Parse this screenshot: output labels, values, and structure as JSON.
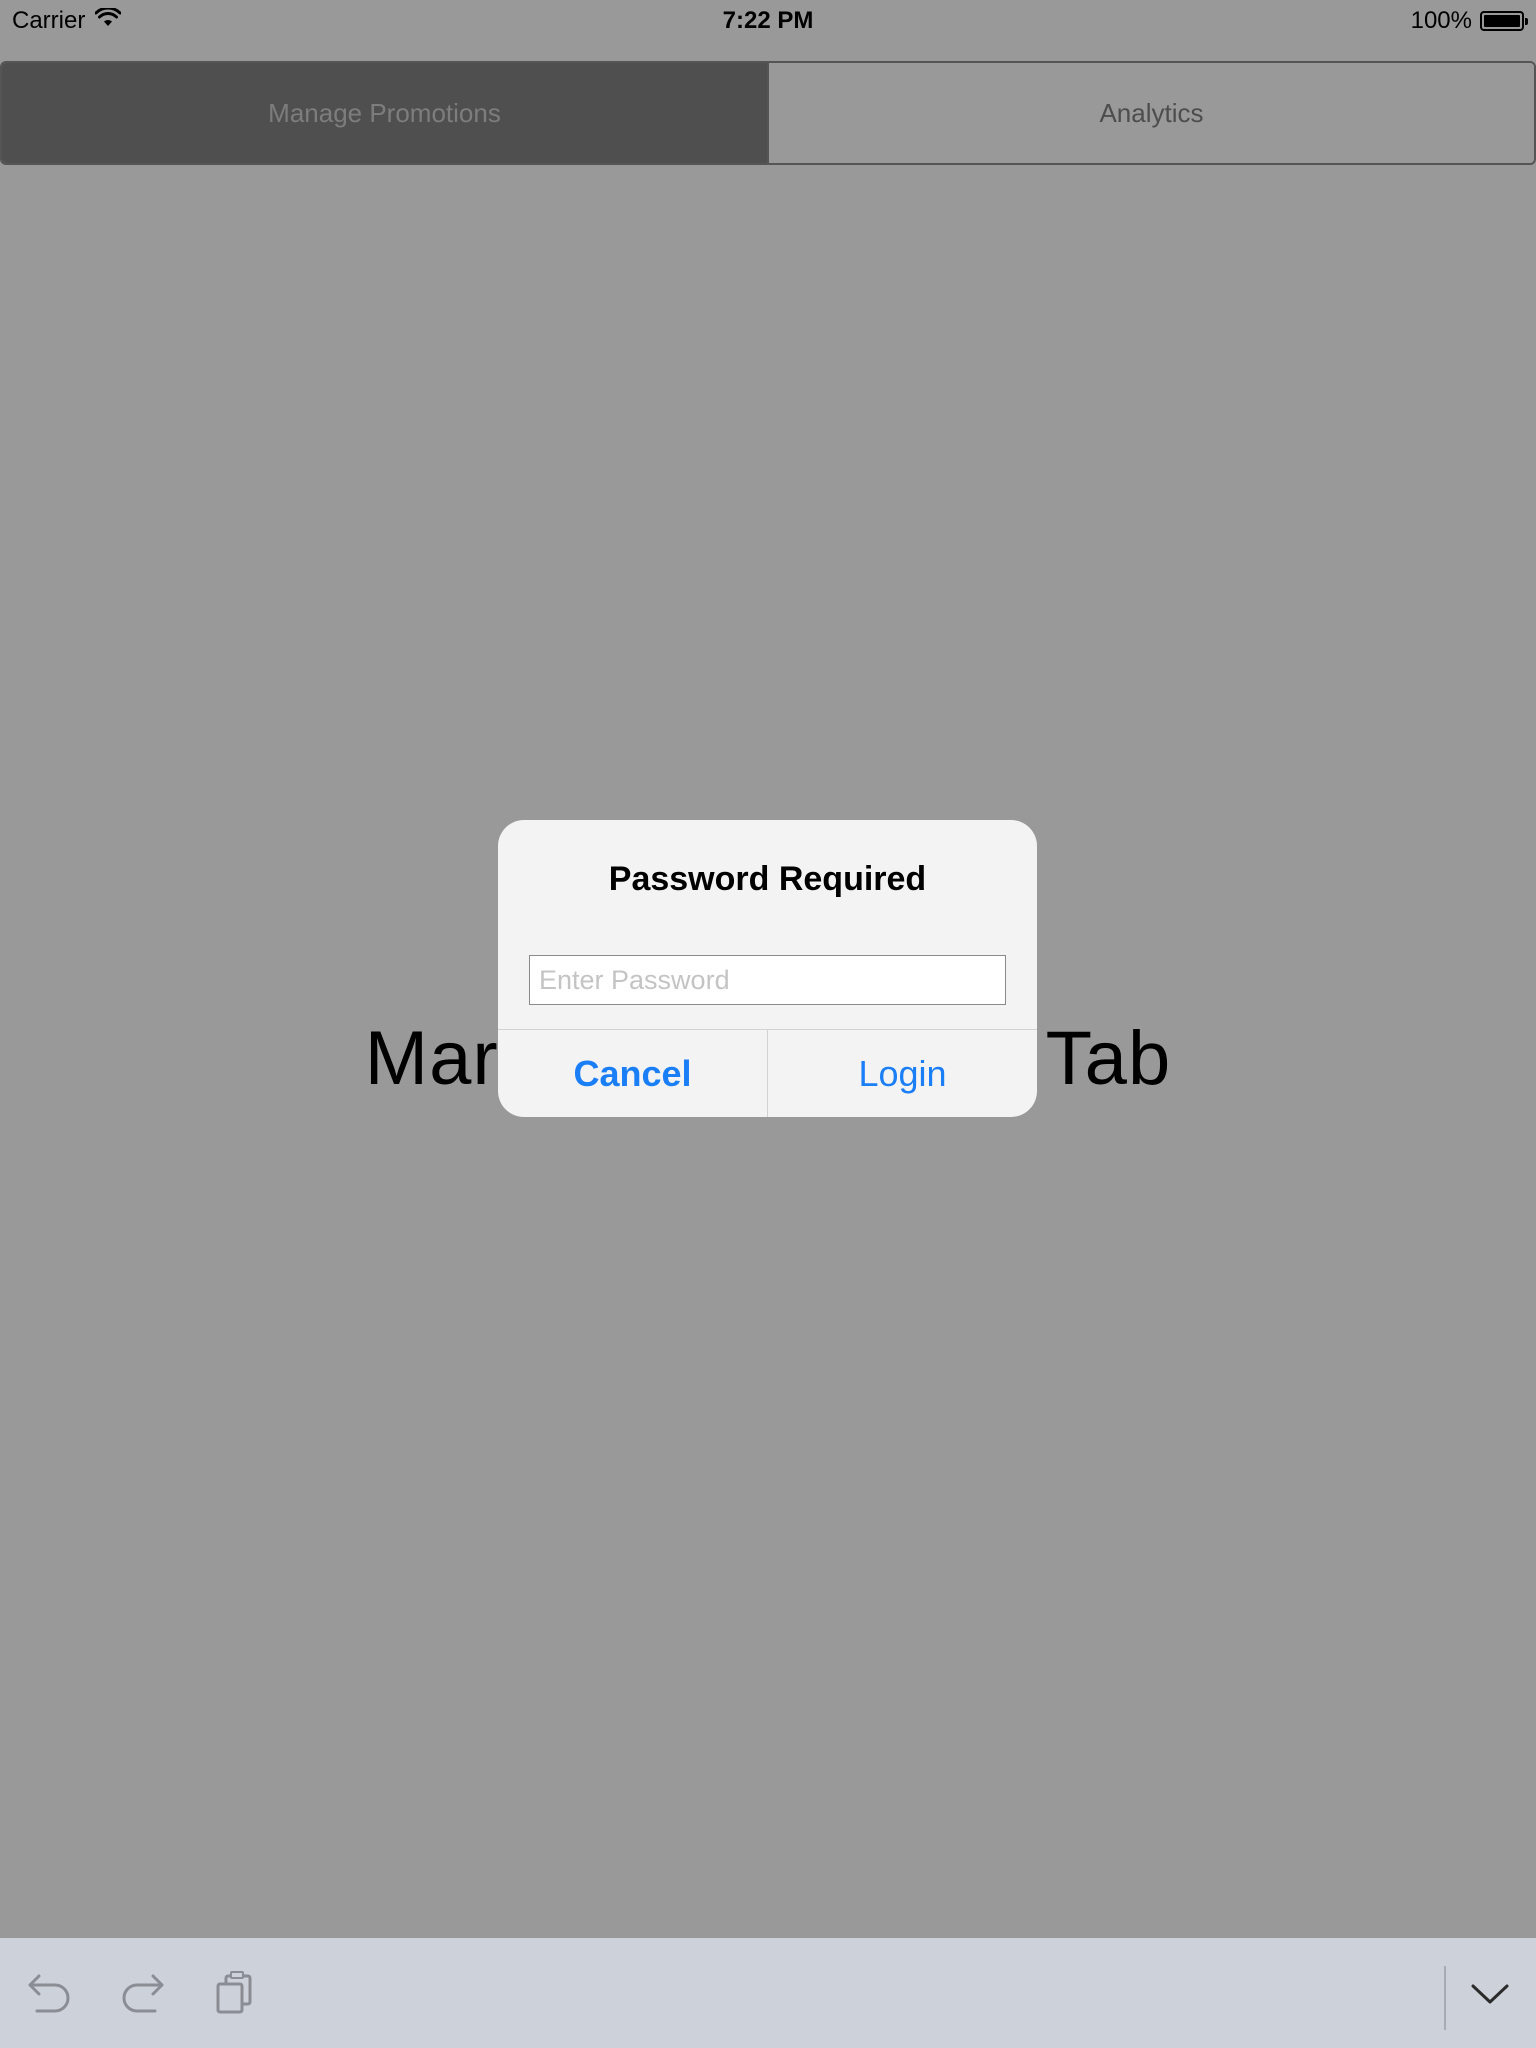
{
  "status_bar": {
    "carrier": "Carrier",
    "time": "7:22 PM",
    "battery": "100%"
  },
  "tabs": [
    {
      "label": "Manage Promotions",
      "active": true
    },
    {
      "label": "Analytics",
      "active": false
    }
  ],
  "background_label": {
    "left_visible": "Mar",
    "right_visible": "Tab"
  },
  "alert": {
    "title": "Password Required",
    "input_placeholder": "Enter Password",
    "input_value": "",
    "cancel_label": "Cancel",
    "login_label": "Login"
  },
  "toolbar": {
    "icons": [
      "undo-icon",
      "redo-icon",
      "paste-icon",
      "dismiss-keyboard-icon"
    ]
  },
  "colors": {
    "accent": "#1a7ef7",
    "dimmed_background": "#999999",
    "active_tab": "#4f4f4f",
    "toolbar_background": "#cdd1d9"
  }
}
